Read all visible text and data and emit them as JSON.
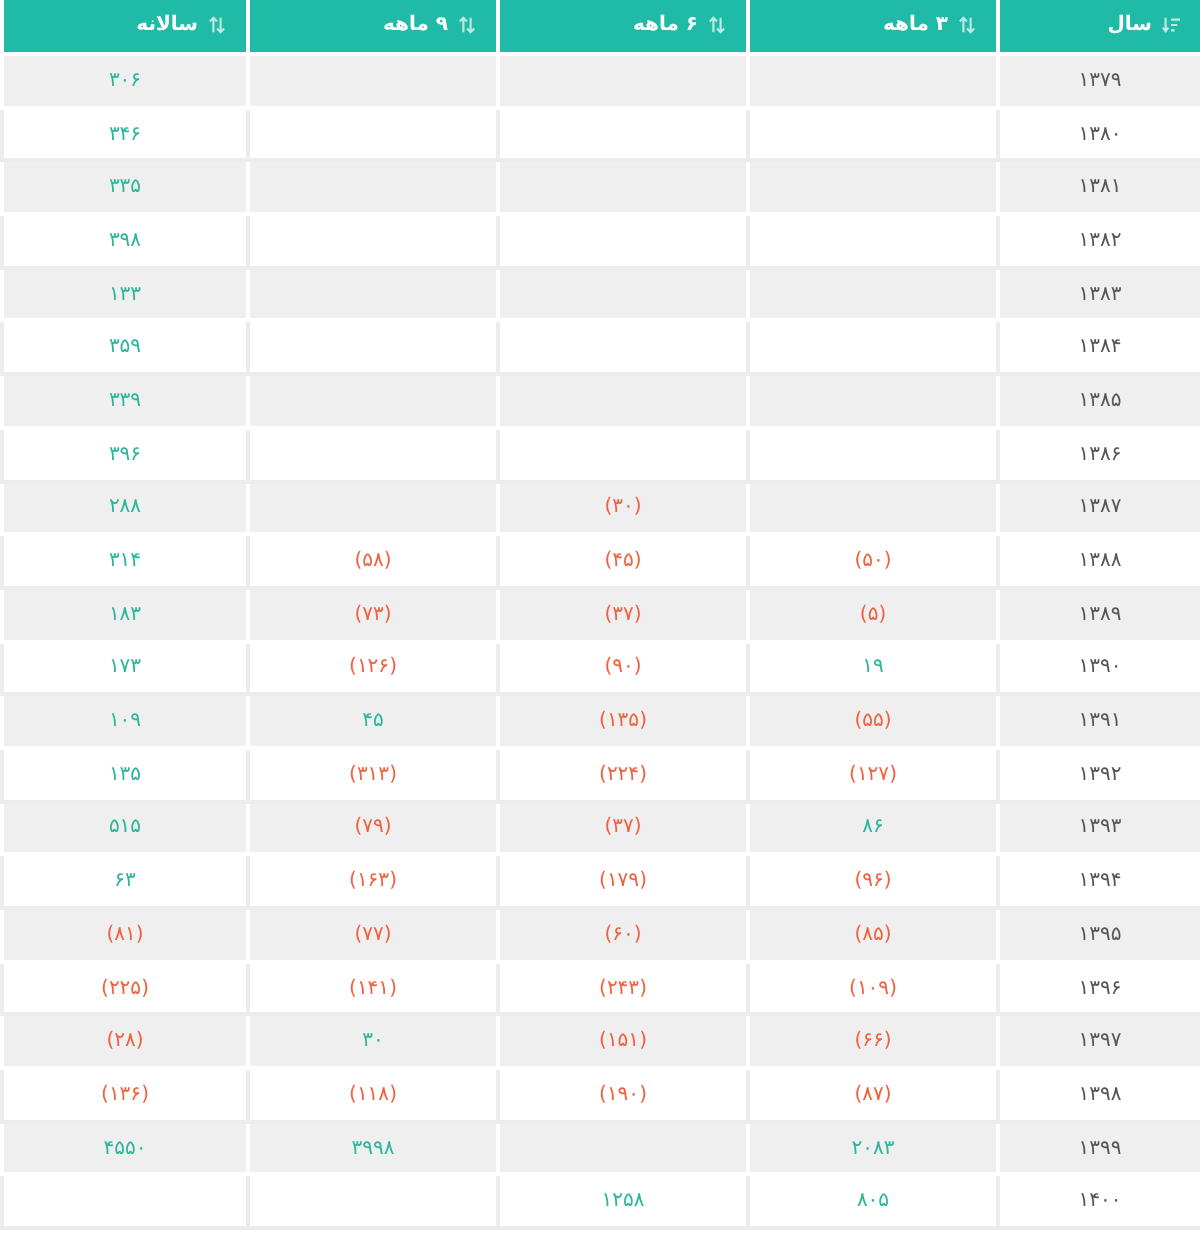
{
  "table": {
    "columns": [
      {
        "label": "سال",
        "sorted": true
      },
      {
        "label": "۳ ماهه",
        "sorted": false
      },
      {
        "label": "۶ ماهه",
        "sorted": false
      },
      {
        "label": "۹ ماهه",
        "sorted": false
      },
      {
        "label": "سالانه",
        "sorted": false
      }
    ],
    "rows": [
      {
        "cells": [
          "۱۳۷۹",
          "",
          "",
          "",
          {
            "text": "۳۰۶",
            "negative": false
          }
        ]
      },
      {
        "cells": [
          "۱۳۸۰",
          "",
          "",
          "",
          {
            "text": "۳۴۶",
            "negative": false
          }
        ]
      },
      {
        "cells": [
          "۱۳۸۱",
          "",
          "",
          "",
          {
            "text": "۳۳۵",
            "negative": false
          }
        ]
      },
      {
        "cells": [
          "۱۳۸۲",
          "",
          "",
          "",
          {
            "text": "۳۹۸",
            "negative": false
          }
        ]
      },
      {
        "cells": [
          "۱۳۸۳",
          "",
          "",
          "",
          {
            "text": "۱۳۳",
            "negative": false
          }
        ]
      },
      {
        "cells": [
          "۱۳۸۴",
          "",
          "",
          "",
          {
            "text": "۳۵۹",
            "negative": false
          }
        ]
      },
      {
        "cells": [
          "۱۳۸۵",
          "",
          "",
          "",
          {
            "text": "۳۳۹",
            "negative": false
          }
        ]
      },
      {
        "cells": [
          "۱۳۸۶",
          "",
          "",
          "",
          {
            "text": "۳۹۶",
            "negative": false
          }
        ]
      },
      {
        "cells": [
          "۱۳۸۷",
          "",
          {
            "text": "(۳۰)",
            "negative": true
          },
          "",
          {
            "text": "۲۸۸",
            "negative": false
          }
        ]
      },
      {
        "cells": [
          "۱۳۸۸",
          {
            "text": "(۵۰)",
            "negative": true
          },
          {
            "text": "(۴۵)",
            "negative": true
          },
          {
            "text": "(۵۸)",
            "negative": true
          },
          {
            "text": "۳۱۴",
            "negative": false
          }
        ]
      },
      {
        "cells": [
          "۱۳۸۹",
          {
            "text": "(۵)",
            "negative": true
          },
          {
            "text": "(۳۷)",
            "negative": true
          },
          {
            "text": "(۷۳)",
            "negative": true
          },
          {
            "text": "۱۸۳",
            "negative": false
          }
        ]
      },
      {
        "cells": [
          "۱۳۹۰",
          {
            "text": "۱۹",
            "negative": false
          },
          {
            "text": "(۹۰)",
            "negative": true
          },
          {
            "text": "(۱۲۶)",
            "negative": true
          },
          {
            "text": "۱۷۳",
            "negative": false
          }
        ]
      },
      {
        "cells": [
          "۱۳۹۱",
          {
            "text": "(۵۵)",
            "negative": true
          },
          {
            "text": "(۱۳۵)",
            "negative": true
          },
          {
            "text": "۴۵",
            "negative": false
          },
          {
            "text": "۱۰۹",
            "negative": false
          }
        ]
      },
      {
        "cells": [
          "۱۳۹۲",
          {
            "text": "(۱۲۷)",
            "negative": true
          },
          {
            "text": "(۲۲۴)",
            "negative": true
          },
          {
            "text": "(۳۱۳)",
            "negative": true
          },
          {
            "text": "۱۳۵",
            "negative": false
          }
        ]
      },
      {
        "cells": [
          "۱۳۹۳",
          {
            "text": "۸۶",
            "negative": false
          },
          {
            "text": "(۳۷)",
            "negative": true
          },
          {
            "text": "(۷۹)",
            "negative": true
          },
          {
            "text": "۵۱۵",
            "negative": false
          }
        ]
      },
      {
        "cells": [
          "۱۳۹۴",
          {
            "text": "(۹۶)",
            "negative": true
          },
          {
            "text": "(۱۷۹)",
            "negative": true
          },
          {
            "text": "(۱۶۳)",
            "negative": true
          },
          {
            "text": "۶۳",
            "negative": false
          }
        ]
      },
      {
        "cells": [
          "۱۳۹۵",
          {
            "text": "(۸۵)",
            "negative": true
          },
          {
            "text": "(۶۰)",
            "negative": true
          },
          {
            "text": "(۷۷)",
            "negative": true
          },
          {
            "text": "(۸۱)",
            "negative": true
          }
        ]
      },
      {
        "cells": [
          "۱۳۹۶",
          {
            "text": "(۱۰۹)",
            "negative": true
          },
          {
            "text": "(۲۴۳)",
            "negative": true
          },
          {
            "text": "(۱۴۱)",
            "negative": true
          },
          {
            "text": "(۲۲۵)",
            "negative": true
          }
        ]
      },
      {
        "cells": [
          "۱۳۹۷",
          {
            "text": "(۶۶)",
            "negative": true
          },
          {
            "text": "(۱۵۱)",
            "negative": true
          },
          {
            "text": "۳۰",
            "negative": false
          },
          {
            "text": "(۲۸)",
            "negative": true
          }
        ]
      },
      {
        "cells": [
          "۱۳۹۸",
          {
            "text": "(۸۷)",
            "negative": true
          },
          {
            "text": "(۱۹۰)",
            "negative": true
          },
          {
            "text": "(۱۱۸)",
            "negative": true
          },
          {
            "text": "(۱۳۶)",
            "negative": true
          }
        ]
      },
      {
        "cells": [
          "۱۳۹۹",
          {
            "text": "۲۰۸۳",
            "negative": false
          },
          "",
          {
            "text": "۳۹۹۸",
            "negative": false
          },
          {
            "text": "۴۵۵۰",
            "negative": false
          }
        ]
      },
      {
        "cells": [
          "۱۴۰۰",
          {
            "text": "۸۰۵",
            "negative": false
          },
          {
            "text": "۱۲۵۸",
            "negative": false
          },
          "",
          ""
        ]
      }
    ]
  }
}
